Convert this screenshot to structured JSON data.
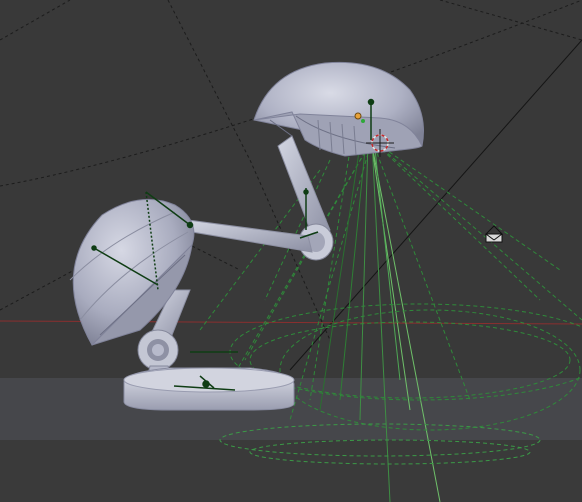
{
  "app": {
    "name": "3D Viewport",
    "background_color": "#393939",
    "floor_color": "#45464a"
  },
  "scene": {
    "objects": [
      "desk-lamp-upper-shade",
      "desk-lamp-lower-shade",
      "desk-lamp-arm",
      "desk-lamp-base",
      "floor-plane"
    ],
    "lights": [
      "spot-light",
      "area-light"
    ],
    "cursor_icon": "3d-cursor-icon",
    "empty_icon": "camera-empty-icon"
  },
  "colors": {
    "grid_line": "#1a1a1a",
    "x_axis": "#8a2f2f",
    "mesh": "#b9bccb",
    "mesh_shadow": "#7d8094",
    "light_line": "#2e8b3a",
    "light_line_bright": "#6fc16a",
    "rig_line": "#0e3a12"
  }
}
